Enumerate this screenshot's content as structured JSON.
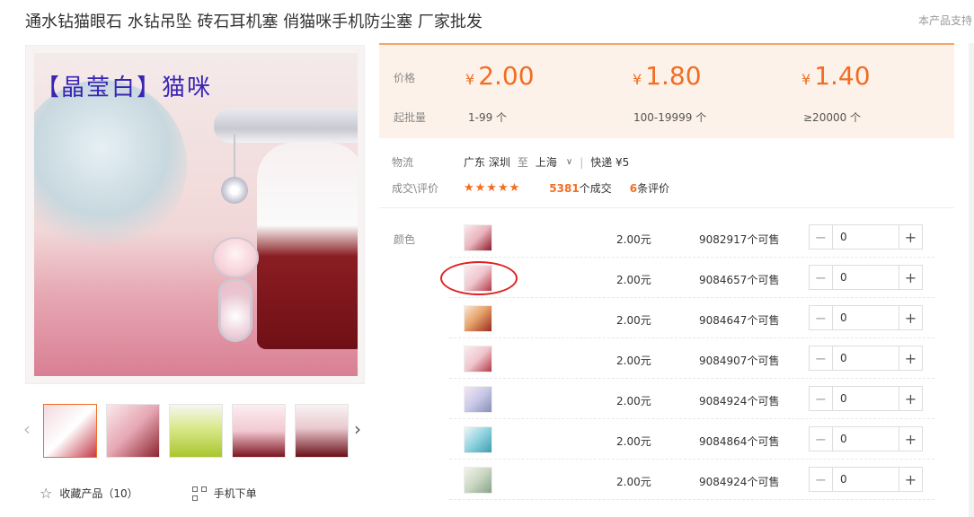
{
  "header": {
    "title": "通水钻猫眼石 水钻吊坠 砖石耳机塞 俏猫咪手机防尘塞 厂家批发",
    "right_text": "本产品支持"
  },
  "gallery": {
    "overlay_text": "【晶莹白】猫咪",
    "prev_icon": "‹",
    "next_icon": "›"
  },
  "actions": {
    "favorite": "收藏产品（10）",
    "mobile_order": "手机下单"
  },
  "pricing": {
    "price_label": "价格",
    "qty_label": "起批量",
    "currency": "¥",
    "tiers": [
      {
        "price": "2.00",
        "range": "1-99 个"
      },
      {
        "price": "1.80",
        "range": "100-19999 个"
      },
      {
        "price": "1.40",
        "range": "≥20000 个"
      }
    ]
  },
  "logistics": {
    "label": "物流",
    "origin": "广东 深圳",
    "to": "至",
    "destination": "上海",
    "express": "快递 ¥5"
  },
  "reviews": {
    "label": "成交\\评价",
    "stars": "★★★★★",
    "deals_count": "5381",
    "deals_suffix": "个成交",
    "review_count": "6",
    "review_suffix": "条评价"
  },
  "variants": {
    "label": "颜色",
    "rows": [
      {
        "price": "2.00元",
        "stock": "9082917个可售",
        "qty": "0"
      },
      {
        "price": "2.00元",
        "stock": "9084657个可售",
        "qty": "0"
      },
      {
        "price": "2.00元",
        "stock": "9084647个可售",
        "qty": "0"
      },
      {
        "price": "2.00元",
        "stock": "9084907个可售",
        "qty": "0"
      },
      {
        "price": "2.00元",
        "stock": "9084924个可售",
        "qty": "0"
      },
      {
        "price": "2.00元",
        "stock": "9084864个可售",
        "qty": "0"
      },
      {
        "price": "2.00元",
        "stock": "9084924个可售",
        "qty": "0"
      }
    ]
  },
  "stepper_icons": {
    "minus": "−",
    "plus": "+"
  },
  "colors": {
    "accent": "#f26d22",
    "price_bg": "#fdf2e9",
    "annotation": "#e02020"
  }
}
